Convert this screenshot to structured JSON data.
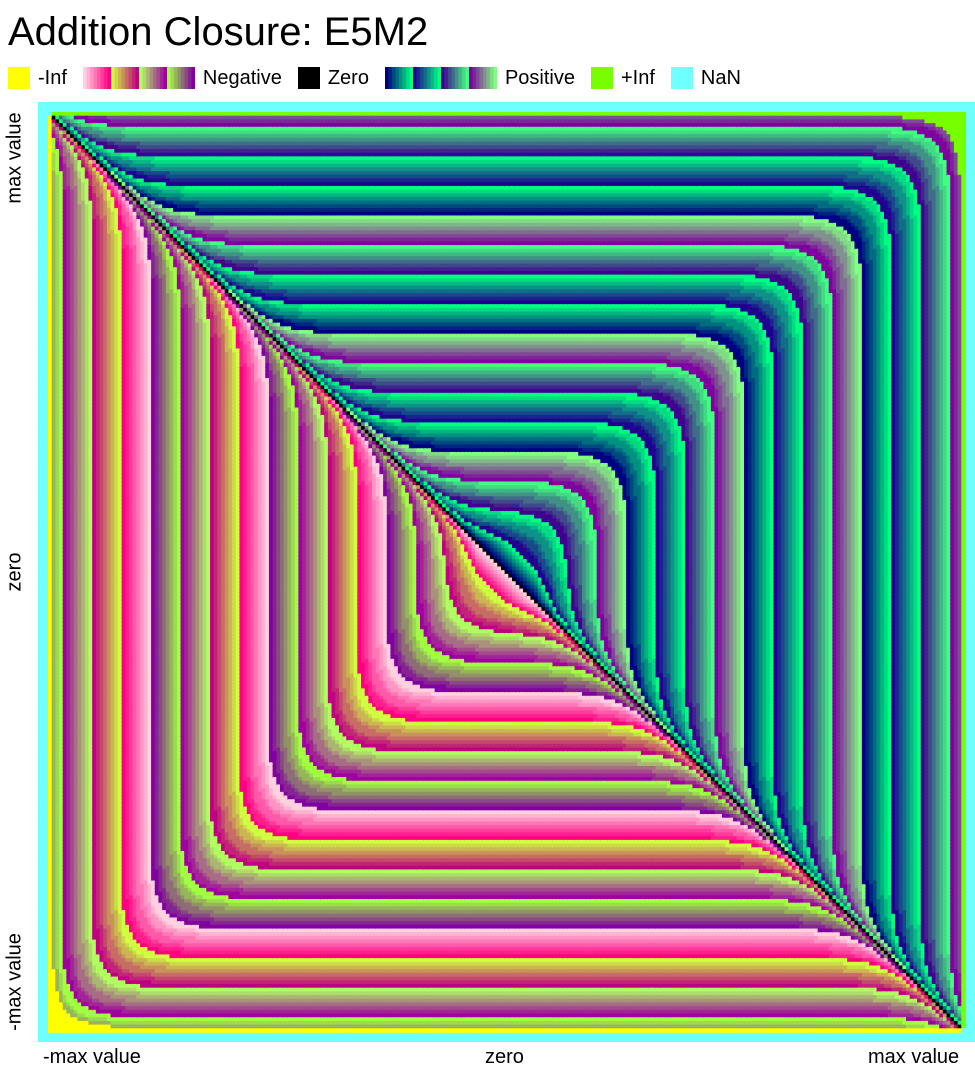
{
  "chart_data": {
    "type": "heatmap",
    "title": "Addition Closure: E5M2",
    "format": "E5M2",
    "operation": "addition",
    "exponent_bits": 5,
    "mantissa_bits": 2,
    "xlabel": "",
    "ylabel": "",
    "x_tick_labels": [
      "-max value",
      "zero",
      "max value"
    ],
    "y_tick_labels": [
      "max value",
      "zero",
      "-max value"
    ],
    "x_range": [
      "-max value",
      "max value"
    ],
    "y_range": [
      "-max value",
      "max value"
    ],
    "legend_position": "top",
    "legend": [
      {
        "label": "-Inf",
        "kind": "swatch",
        "color": "#ffff00"
      },
      {
        "label": "Negative",
        "kind": "gradient",
        "colors": [
          "#ffd0e0",
          "#ff6090",
          "#ff0080",
          "#d0ff40",
          "#c08080",
          "#a0ff40",
          "#8000a0"
        ]
      },
      {
        "label": "Zero",
        "kind": "swatch",
        "color": "#000000"
      },
      {
        "label": "Positive",
        "kind": "gradient",
        "colors": [
          "#000080",
          "#00ff80",
          "#200090",
          "#00ff80",
          "#400090",
          "#80ff80",
          "#8000a0"
        ]
      },
      {
        "label": "+Inf",
        "kind": "swatch",
        "color": "#77ff00"
      },
      {
        "label": "NaN",
        "kind": "swatch",
        "color": "#70ffff"
      }
    ],
    "cell_colors": {
      "neg_inf": "#ffff00",
      "zero": "#000000",
      "pos_inf": "#77ff00",
      "nan": "#70ffff"
    },
    "grid": false
  }
}
